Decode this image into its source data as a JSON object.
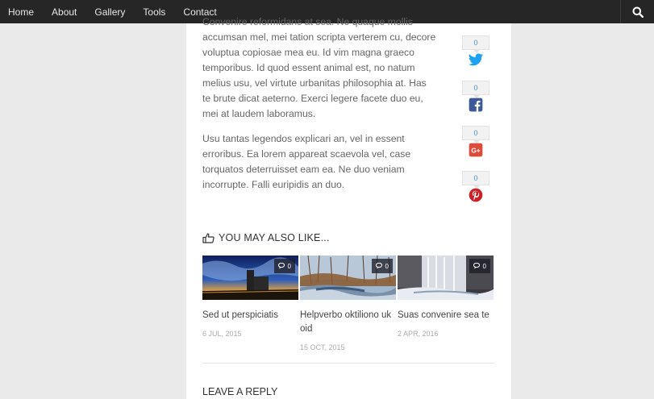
{
  "nav": {
    "items": [
      {
        "label": "Home"
      },
      {
        "label": "About"
      },
      {
        "label": "Gallery"
      },
      {
        "label": "Tools"
      },
      {
        "label": "Contact"
      }
    ],
    "search_icon": "search-icon"
  },
  "post": {
    "para1_prefix": "Convenire reformidans at sea. Ne quaque mollis ",
    "para1": "accumsan mel, mei tation scripta verterem cu, decore voluptua copiosae mea eu. Id vim magna graeco temporibus. Id quod essent animal est, no natum melius usu, vel virtute urbanitas philosophia at. Has te brute dicat aeterno. Exerci legere facete duo eu, mei at laudem laboramus.",
    "para2": "Usu tantas legendos explicari an, vel in essent erroribus. Ea lorem appareat scaevola vel, case torquatos deterruisset eam ea. Ne duo veniam incorrupte. Falli euripidis an duo."
  },
  "share": [
    {
      "network": "twitter",
      "count": "0",
      "icon": "twitter-icon",
      "color": "#1da1f2"
    },
    {
      "network": "facebook",
      "count": "0",
      "icon": "facebook-icon",
      "color": "#3b5998"
    },
    {
      "network": "google-plus",
      "count": "0",
      "icon": "google-plus-icon",
      "color": "#dd4b39"
    },
    {
      "network": "pinterest",
      "count": "0",
      "icon": "pinterest-icon",
      "color": "#cb2027"
    }
  ],
  "related": {
    "heading": "YOU MAY ALSO LIKE...",
    "icon": "thumbs-up-icon",
    "posts": [
      {
        "title": "Sed ut perspiciatis",
        "date": "6 JUL, 2015",
        "comments": "0"
      },
      {
        "title": "Helpverbo oktiliono uk oid",
        "date": "15 OCT, 2015",
        "comments": "0"
      },
      {
        "title": "Suas convenire sea te",
        "date": "2 APR, 2016",
        "comments": "0"
      }
    ]
  },
  "reply": {
    "title": "LEAVE A REPLY"
  }
}
